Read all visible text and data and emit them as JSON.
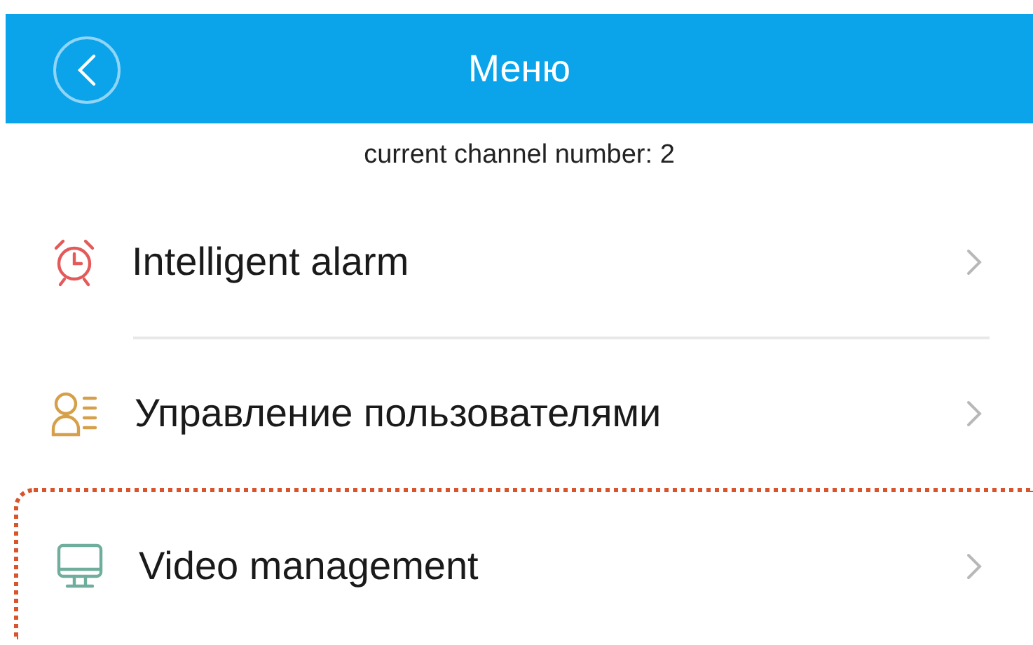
{
  "header": {
    "title": "Меню"
  },
  "subtitle": "current channel number: 2",
  "items": [
    {
      "label": "Intelligent alarm",
      "kind": "alarm",
      "highlighted": false
    },
    {
      "label": "Управление пользователями",
      "kind": "users",
      "highlighted": false
    },
    {
      "label": "Video management",
      "kind": "monitor",
      "highlighted": true
    }
  ]
}
